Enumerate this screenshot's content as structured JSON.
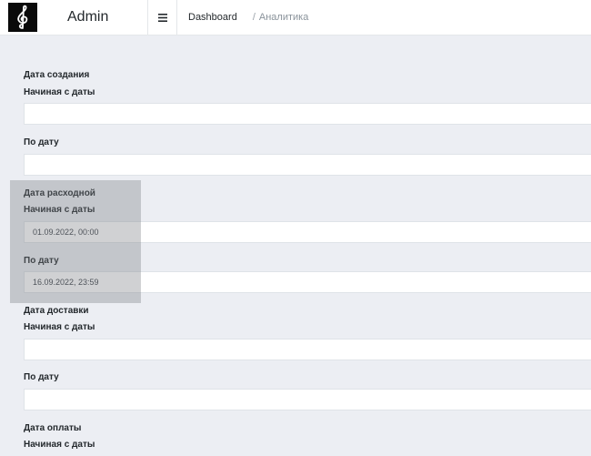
{
  "header": {
    "brand": "Admin",
    "logo_icon": "treble-clef-icon",
    "menu_icon": "hamburger-icon",
    "breadcrumb": {
      "home": "Dashboard",
      "separator": "/",
      "current": "Аналитика"
    }
  },
  "filters": [
    {
      "group": "Дата создания",
      "from_label": "Начиная с даты",
      "from_value": "",
      "to_label": "По дату",
      "to_value": ""
    },
    {
      "group": "Дата расходной",
      "from_label": "Начиная с даты",
      "from_value": "01.09.2022, 00:00",
      "to_label": "По дату",
      "to_value": "16.09.2022, 23:59"
    },
    {
      "group": "Дата доставки",
      "from_label": "Начиная с даты",
      "from_value": "",
      "to_label": "По дату",
      "to_value": ""
    },
    {
      "group": "Дата оплаты",
      "from_label": "Начиная с даты"
    }
  ]
}
